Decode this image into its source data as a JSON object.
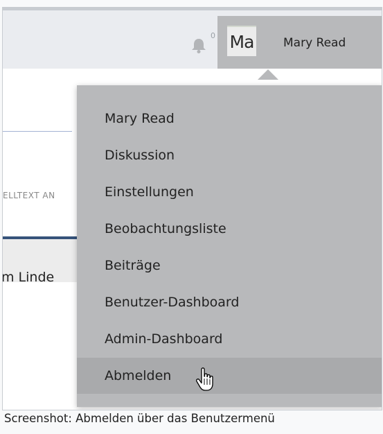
{
  "header": {
    "notification_count": "0",
    "avatar_initials": "Ma",
    "user_name": "Mary Read",
    "icons": {
      "notifications": "bell-icon",
      "cursor": "hand-pointer-icon"
    }
  },
  "background": {
    "tab_label": "ELLTEXT AN",
    "list_text": "m Linde"
  },
  "menu": {
    "items": [
      {
        "label": "Mary Read"
      },
      {
        "label": "Diskussion"
      },
      {
        "label": "Einstellungen"
      },
      {
        "label": "Beobachtungsliste"
      },
      {
        "label": "Beiträge"
      },
      {
        "label": "Benutzer-Dashboard"
      },
      {
        "label": "Admin-Dashboard"
      },
      {
        "label": "Abmelden"
      }
    ],
    "hovered": "Abmelden"
  },
  "caption": "Screenshot: Abmelden über das Benutzermenü",
  "colors": {
    "menu_bg": "#b8b9bb",
    "menu_hover": "#a9aaac",
    "accent": "#36537a"
  }
}
